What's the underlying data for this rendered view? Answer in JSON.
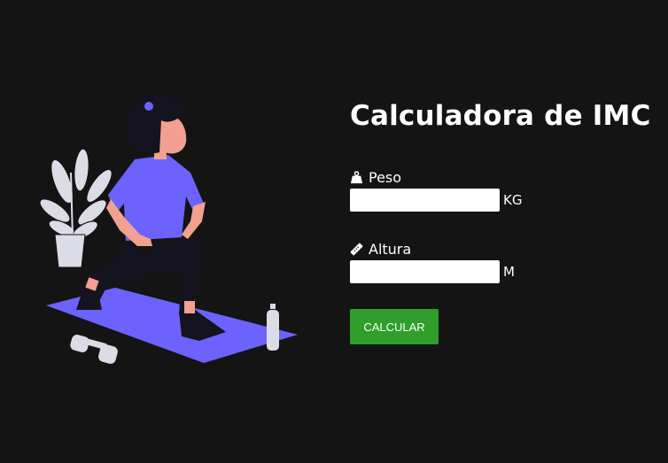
{
  "title": "Calculadora de IMC",
  "peso": {
    "label": "Peso",
    "value": "",
    "unit": "KG",
    "icon": "weight-icon"
  },
  "altura": {
    "label": "Altura",
    "value": "",
    "unit": "M",
    "icon": "ruler-icon"
  },
  "button": {
    "label": "CALCULAR"
  },
  "illustration": {
    "icon": "workout-illustration"
  },
  "colors": {
    "background": "#141414",
    "accent": "#6c63ff",
    "button": "#2f9e2a",
    "text": "#ffffff"
  }
}
